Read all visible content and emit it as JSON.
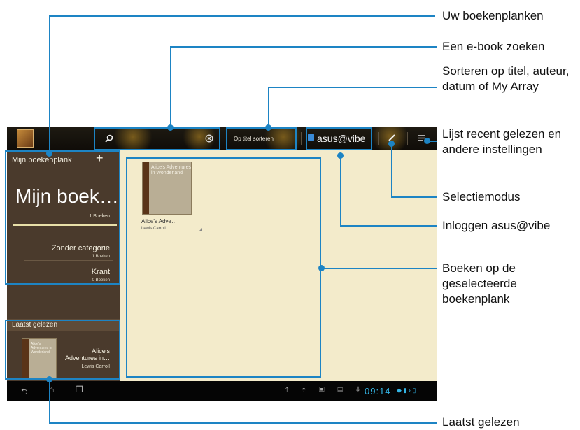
{
  "annotations": {
    "shelves": "Uw boekenplanken",
    "search": "Een e-book zoeken",
    "sort": "Sorteren op titel, auteur, datum of My Array",
    "recent": "Lijst recent gelezen en andere instellingen",
    "select": "Selectiemodus",
    "login": "Inloggen asus@vibe",
    "books": "Boeken op de geselecteerde boekenplank",
    "last_read": "Laatst gelezen"
  },
  "toolbar": {
    "sort_label": "Op titel sorteren",
    "brand": "asus@vibe"
  },
  "sidebar": {
    "header": "Mijn boekenplank",
    "current_shelf": "Mijn boek…",
    "current_count": "1 Boeken",
    "categories": [
      {
        "name": "Zonder categorie",
        "count": "1 Boeken"
      },
      {
        "name": "Krant",
        "count": "0 Boeken"
      }
    ],
    "last_read_header": "Laatst gelezen",
    "last_read_title": "Alice's Adventures in…",
    "last_read_author": "Lewis Carroll"
  },
  "book": {
    "cover_title": "Alice's Adventures in Wonderland",
    "title": "Alice's Adve…",
    "author": "Lewis Carroll"
  },
  "status": {
    "time": "09:14"
  },
  "colors": {
    "accent": "#1d84c4",
    "shelf": "#4a3a2c",
    "content_bg": "#f3ebcb",
    "highlight": "#e8dfa8"
  }
}
